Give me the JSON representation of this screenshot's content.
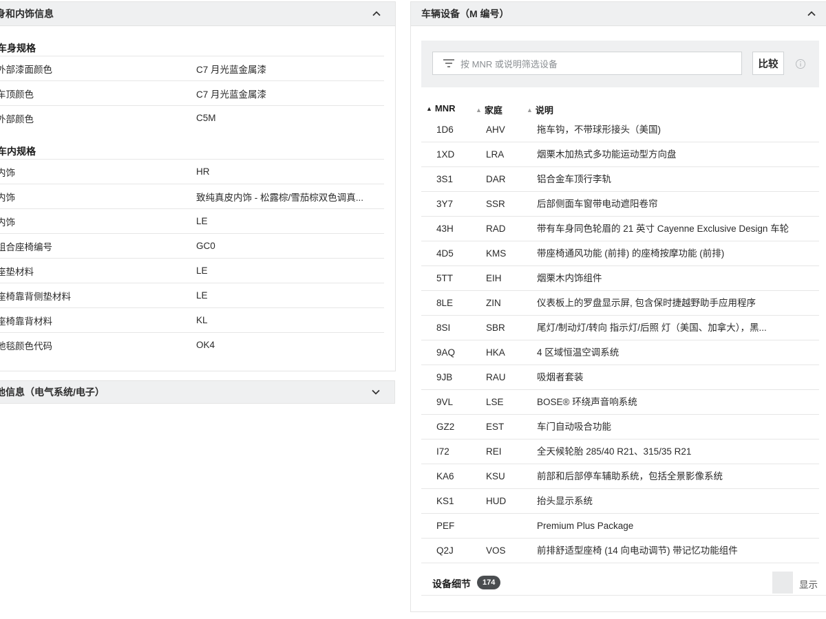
{
  "left": {
    "header_title": "身和内饰信息",
    "body_section_title": "车身规格",
    "body_rows": [
      {
        "label": "外部漆面颜色",
        "value": "C7 月光蓝金属漆"
      },
      {
        "label": "车顶颜色",
        "value": "C7 月光蓝金属漆"
      },
      {
        "label": "外部颜色",
        "value": "C5M"
      }
    ],
    "interior_section_title": "车内规格",
    "interior_rows": [
      {
        "label": "内饰",
        "value": "HR"
      },
      {
        "label": "内饰",
        "value": "致纯真皮内饰 - 松露棕/雪茄棕双色调真..."
      },
      {
        "label": "内饰",
        "value": "LE"
      },
      {
        "label": "组合座椅编号",
        "value": "GC0"
      },
      {
        "label": "座垫材料",
        "value": "LE"
      },
      {
        "label": "座椅靠背侧垫材料",
        "value": "LE"
      },
      {
        "label": "座椅靠背材料",
        "value": "KL"
      },
      {
        "label": "地毯颜色代码",
        "value": "OK4"
      }
    ],
    "other_header_title": "他信息（电气系统/电子）"
  },
  "right": {
    "header_title": "车辆设备（M 编号）",
    "filter_placeholder": "按 MNR 或说明筛选设备",
    "compare_label": "比较",
    "columns": [
      "MNR",
      "家庭",
      "说明"
    ],
    "rows": [
      {
        "mnr": "1D6",
        "family": "AHV",
        "desc": "拖车钩，不带球形接头（美国)"
      },
      {
        "mnr": "1XD",
        "family": "LRA",
        "desc": "烟栗木加热式多功能运动型方向盘"
      },
      {
        "mnr": "3S1",
        "family": "DAR",
        "desc": "铝合金车顶行李轨"
      },
      {
        "mnr": "3Y7",
        "family": "SSR",
        "desc": "后部侧面车窗带电动遮阳卷帘"
      },
      {
        "mnr": "43H",
        "family": "RAD",
        "desc": "带有车身同色轮眉的 21 英寸 Cayenne Exclusive Design 车轮"
      },
      {
        "mnr": "4D5",
        "family": "KMS",
        "desc": "带座椅通风功能 (前排) 的座椅按摩功能 (前排)"
      },
      {
        "mnr": "5TT",
        "family": "EIH",
        "desc": "烟栗木内饰组件"
      },
      {
        "mnr": "8LE",
        "family": "ZIN",
        "desc": "仪表板上的罗盘显示屏, 包含保时捷越野助手应用程序"
      },
      {
        "mnr": "8SI",
        "family": "SBR",
        "desc": "尾灯/制动灯/转向 指示灯/后照 灯（美国、加拿大），黑..."
      },
      {
        "mnr": "9AQ",
        "family": "HKA",
        "desc": "4 区域恒温空调系统"
      },
      {
        "mnr": "9JB",
        "family": "RAU",
        "desc": "吸烟者套装"
      },
      {
        "mnr": "9VL",
        "family": "LSE",
        "desc": "BOSE® 环绕声音响系统"
      },
      {
        "mnr": "GZ2",
        "family": "EST",
        "desc": "车门自动吸合功能"
      },
      {
        "mnr": "I72",
        "family": "REI",
        "desc": "全天候轮胎 285/40 R21、315/35 R21"
      },
      {
        "mnr": "KA6",
        "family": "KSU",
        "desc": "前部和后部停车辅助系统，包括全景影像系统"
      },
      {
        "mnr": "KS1",
        "family": "HUD",
        "desc": "抬头显示系统"
      },
      {
        "mnr": "PEF",
        "family": "",
        "desc": "Premium Plus Package"
      },
      {
        "mnr": "Q2J",
        "family": "VOS",
        "desc": "前排舒适型座椅 (14 向电动调节) 带记忆功能组件"
      }
    ],
    "footer_label": "设备细节",
    "footer_count": "174",
    "show_label": "显示"
  }
}
